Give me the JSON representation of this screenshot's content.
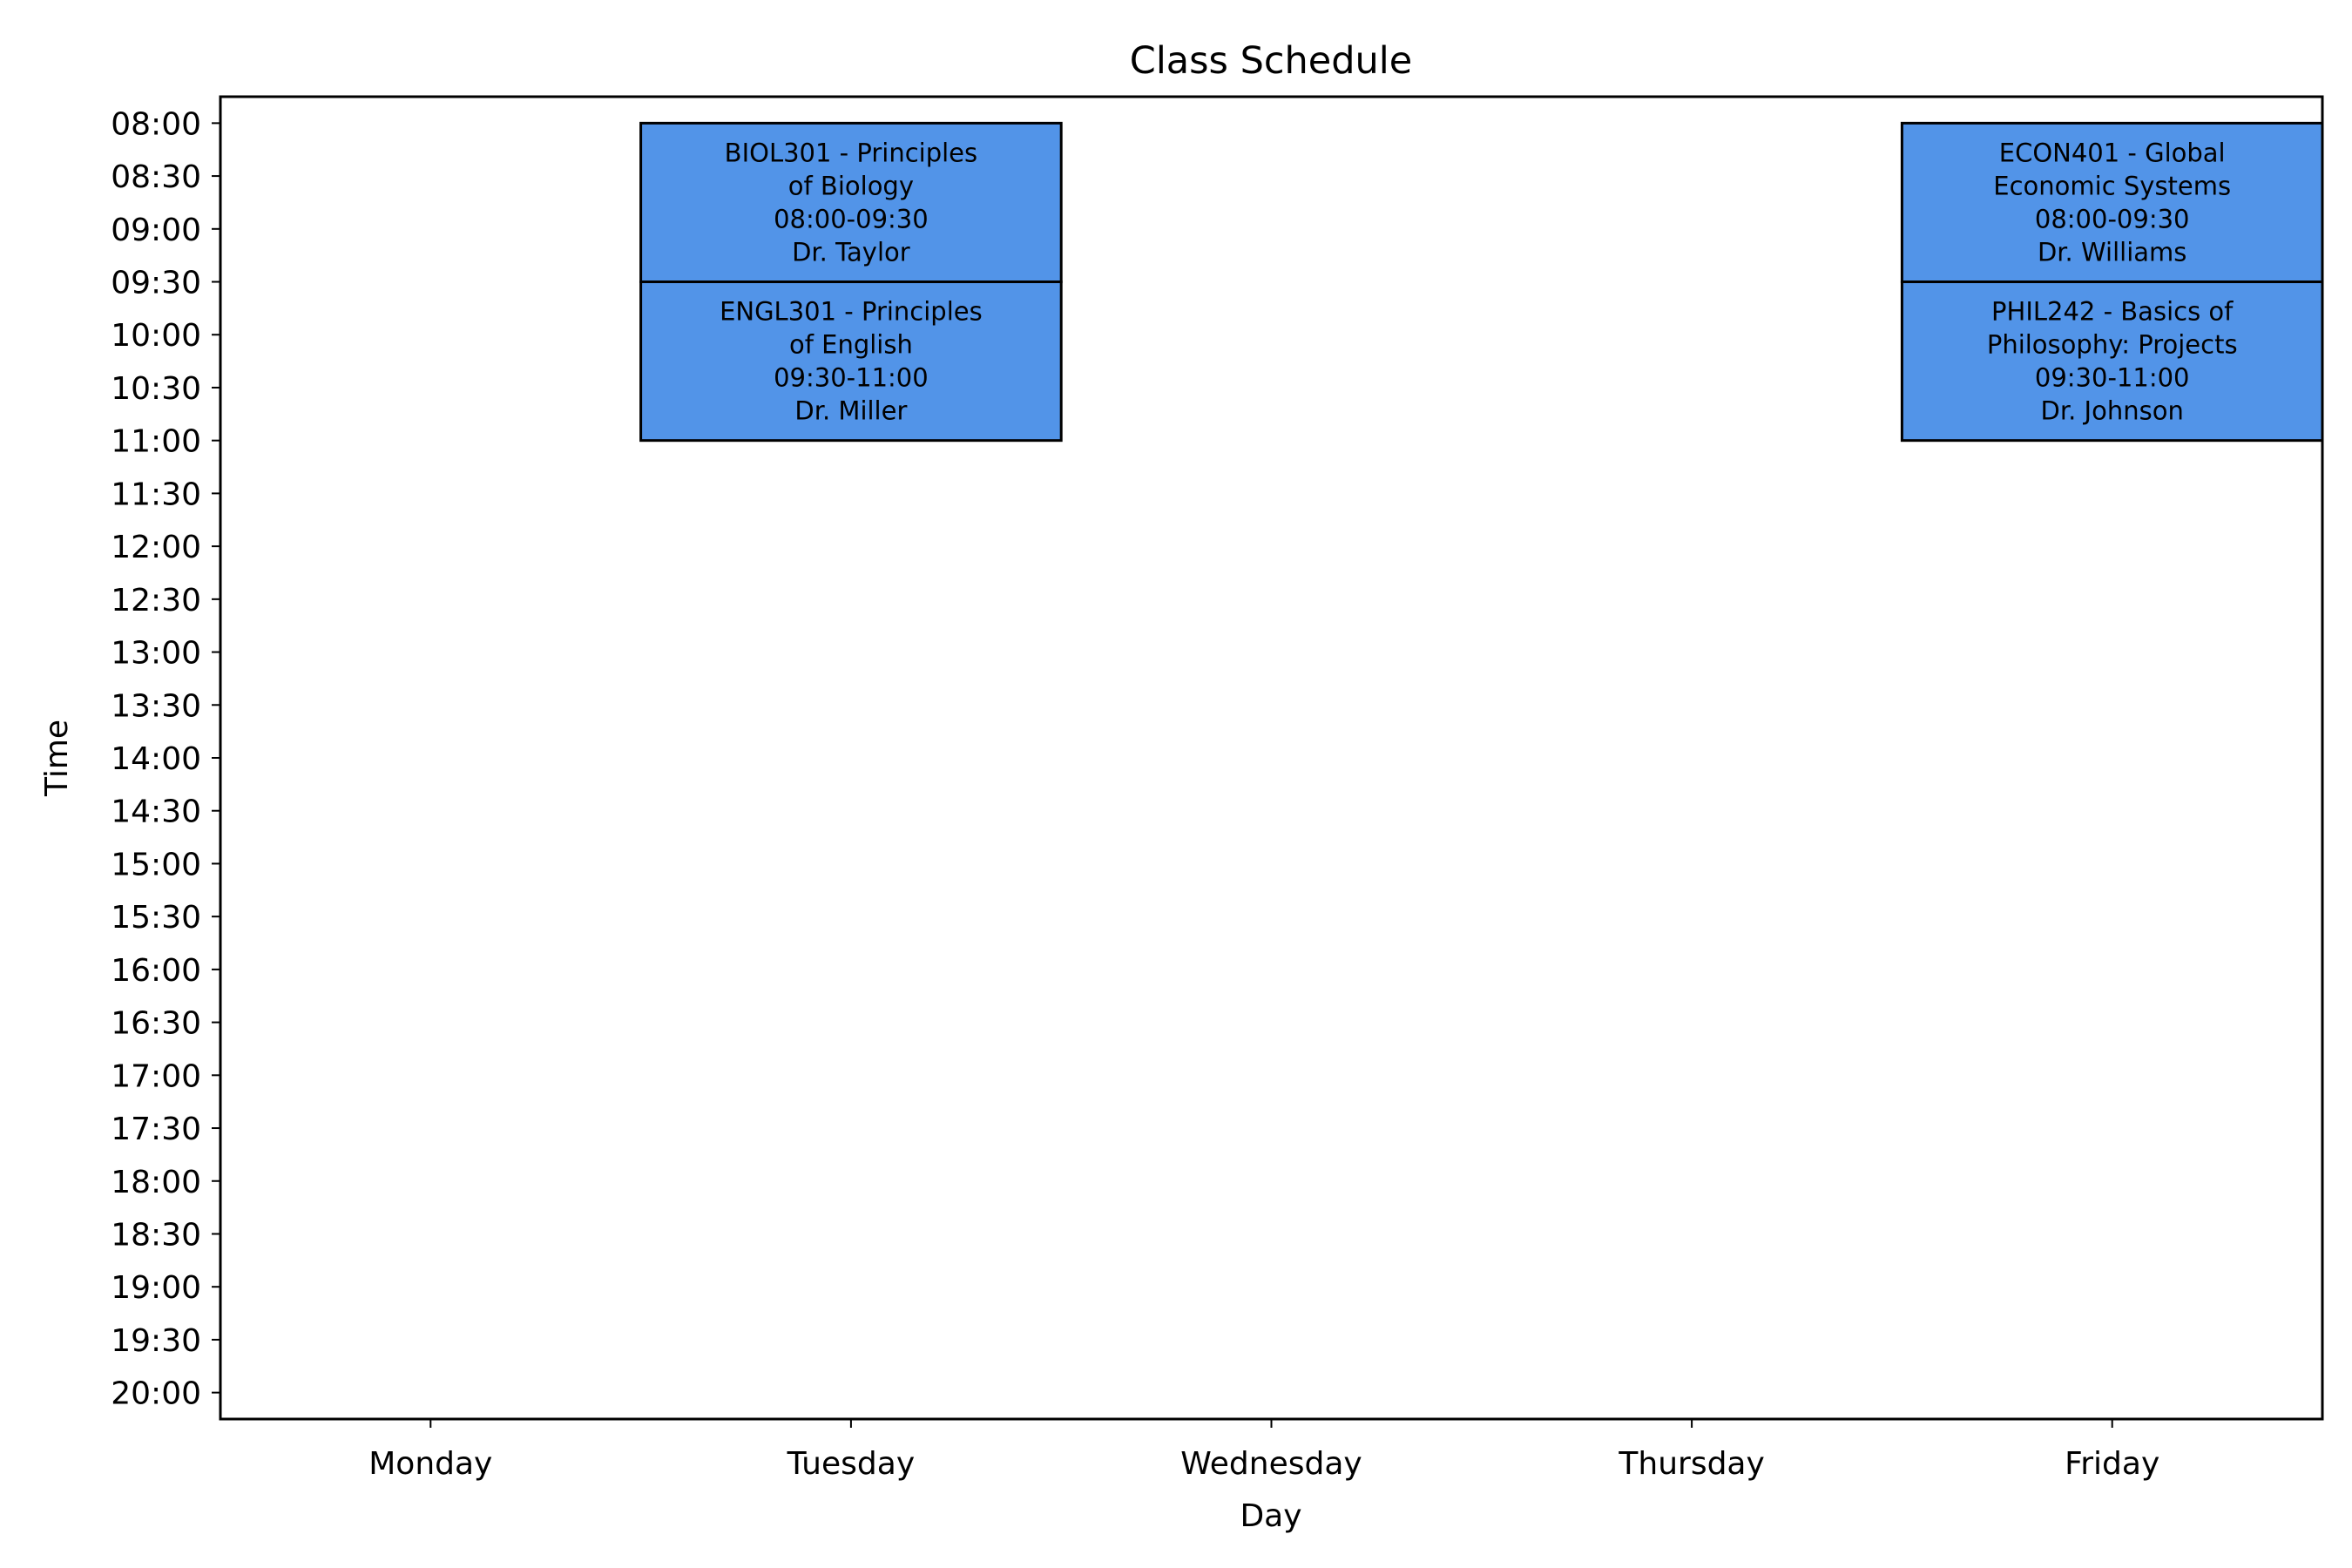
{
  "chart_data": {
    "type": "table",
    "title": "Class Schedule",
    "xlabel": "Day",
    "ylabel": "Time",
    "days": [
      "Monday",
      "Tuesday",
      "Wednesday",
      "Thursday",
      "Friday"
    ],
    "time_ticks": [
      "08:00",
      "08:30",
      "09:00",
      "09:30",
      "10:00",
      "10:30",
      "11:00",
      "11:30",
      "12:00",
      "12:30",
      "13:00",
      "13:30",
      "14:00",
      "14:30",
      "15:00",
      "15:30",
      "16:00",
      "16:30",
      "17:00",
      "17:30",
      "18:00",
      "18:30",
      "19:00",
      "19:30",
      "20:00"
    ],
    "ylim": [
      "07:45",
      "20:15"
    ],
    "y_inverted": true,
    "grid": false,
    "block_color": "#5294E8",
    "block_edge_color": "#000000",
    "classes": [
      {
        "day": "Tuesday",
        "start": "08:00",
        "end": "09:30",
        "lines": [
          "BIOL301 - Principles",
          "of Biology",
          "08:00-09:30",
          "Dr. Taylor"
        ]
      },
      {
        "day": "Tuesday",
        "start": "09:30",
        "end": "11:00",
        "lines": [
          "ENGL301 - Principles",
          "of English",
          "09:30-11:00",
          "Dr. Miller"
        ]
      },
      {
        "day": "Friday",
        "start": "08:00",
        "end": "09:30",
        "lines": [
          "ECON401 - Global",
          "Economic Systems",
          "08:00-09:30",
          "Dr. Williams"
        ]
      },
      {
        "day": "Friday",
        "start": "09:30",
        "end": "11:00",
        "lines": [
          "PHIL242 - Basics of",
          "Philosophy: Projects",
          "09:30-11:00",
          "Dr. Johnson"
        ]
      }
    ]
  }
}
